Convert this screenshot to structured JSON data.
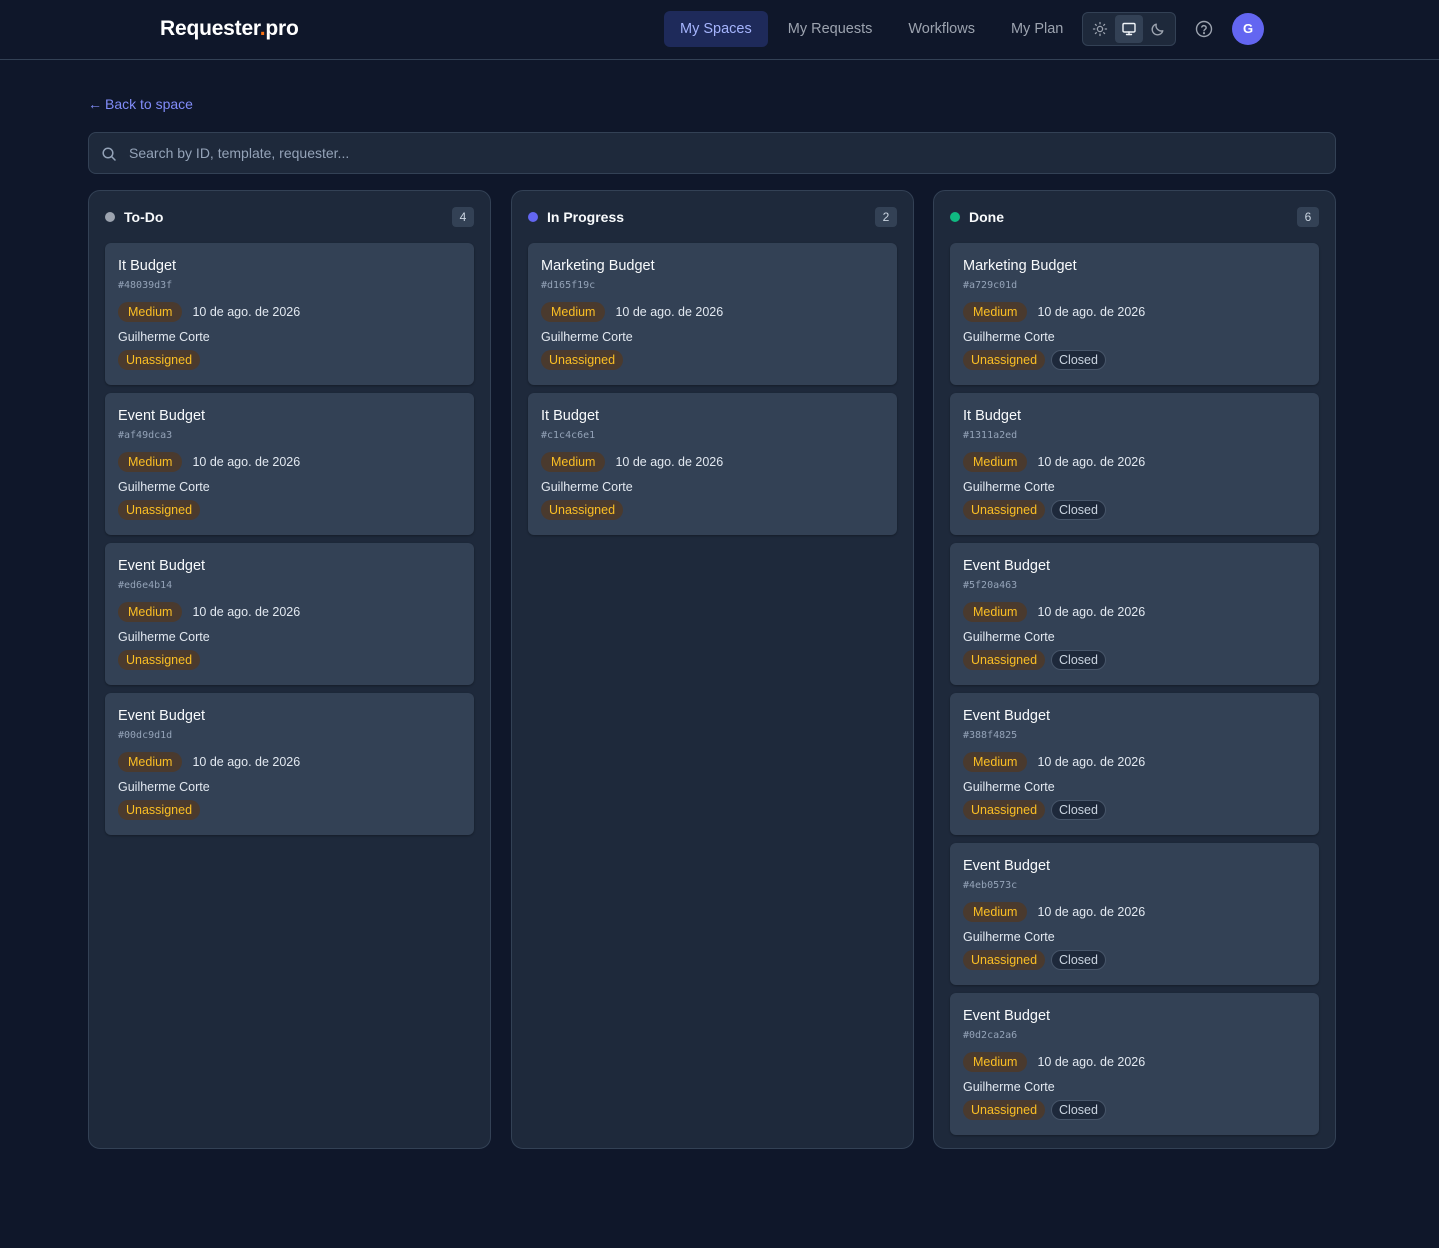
{
  "brand": {
    "name": "Requester",
    "dot": ".",
    "suffix": "pro"
  },
  "nav": [
    {
      "label": "My Spaces",
      "active": true
    },
    {
      "label": "My Requests",
      "active": false
    },
    {
      "label": "Workflows",
      "active": false
    },
    {
      "label": "My Plan",
      "active": false
    }
  ],
  "theme": {
    "options": [
      "sun-icon",
      "monitor-icon",
      "moon-icon"
    ],
    "selected": "monitor-icon"
  },
  "user": {
    "initial": "G"
  },
  "back": {
    "arrow": "←",
    "label": "Back to space"
  },
  "search": {
    "placeholder": "Search by ID, template, requester..."
  },
  "colors": {
    "accent": "#6366f1",
    "todo": "#9ca3af",
    "in_progress": "#6366f1",
    "done": "#10b981",
    "priority": "#fbbf24"
  },
  "columns": [
    {
      "title": "To-Do",
      "count": "4",
      "dot_color": "#9ca3af",
      "cards": [
        {
          "title": "It Budget",
          "id": "#48039d3f",
          "priority": "Medium",
          "date": "10 de ago. de 2026",
          "user": "Guilherme Corte",
          "assignee": "Unassigned",
          "status": ""
        },
        {
          "title": "Event Budget",
          "id": "#af49dca3",
          "priority": "Medium",
          "date": "10 de ago. de 2026",
          "user": "Guilherme Corte",
          "assignee": "Unassigned",
          "status": ""
        },
        {
          "title": "Event Budget",
          "id": "#ed6e4b14",
          "priority": "Medium",
          "date": "10 de ago. de 2026",
          "user": "Guilherme Corte",
          "assignee": "Unassigned",
          "status": ""
        },
        {
          "title": "Event Budget",
          "id": "#00dc9d1d",
          "priority": "Medium",
          "date": "10 de ago. de 2026",
          "user": "Guilherme Corte",
          "assignee": "Unassigned",
          "status": ""
        }
      ]
    },
    {
      "title": "In Progress",
      "count": "2",
      "dot_color": "#6366f1",
      "cards": [
        {
          "title": "Marketing Budget",
          "id": "#d165f19c",
          "priority": "Medium",
          "date": "10 de ago. de 2026",
          "user": "Guilherme Corte",
          "assignee": "Unassigned",
          "status": ""
        },
        {
          "title": "It Budget",
          "id": "#c1c4c6e1",
          "priority": "Medium",
          "date": "10 de ago. de 2026",
          "user": "Guilherme Corte",
          "assignee": "Unassigned",
          "status": ""
        }
      ]
    },
    {
      "title": "Done",
      "count": "6",
      "dot_color": "#10b981",
      "cards": [
        {
          "title": "Marketing Budget",
          "id": "#a729c01d",
          "priority": "Medium",
          "date": "10 de ago. de 2026",
          "user": "Guilherme Corte",
          "assignee": "Unassigned",
          "status": "Closed"
        },
        {
          "title": "It Budget",
          "id": "#1311a2ed",
          "priority": "Medium",
          "date": "10 de ago. de 2026",
          "user": "Guilherme Corte",
          "assignee": "Unassigned",
          "status": "Closed"
        },
        {
          "title": "Event Budget",
          "id": "#5f20a463",
          "priority": "Medium",
          "date": "10 de ago. de 2026",
          "user": "Guilherme Corte",
          "assignee": "Unassigned",
          "status": "Closed"
        },
        {
          "title": "Event Budget",
          "id": "#388f4825",
          "priority": "Medium",
          "date": "10 de ago. de 2026",
          "user": "Guilherme Corte",
          "assignee": "Unassigned",
          "status": "Closed"
        },
        {
          "title": "Event Budget",
          "id": "#4eb0573c",
          "priority": "Medium",
          "date": "10 de ago. de 2026",
          "user": "Guilherme Corte",
          "assignee": "Unassigned",
          "status": "Closed"
        },
        {
          "title": "Event Budget",
          "id": "#0d2ca2a6",
          "priority": "Medium",
          "date": "10 de ago. de 2026",
          "user": "Guilherme Corte",
          "assignee": "Unassigned",
          "status": "Closed"
        }
      ]
    }
  ]
}
